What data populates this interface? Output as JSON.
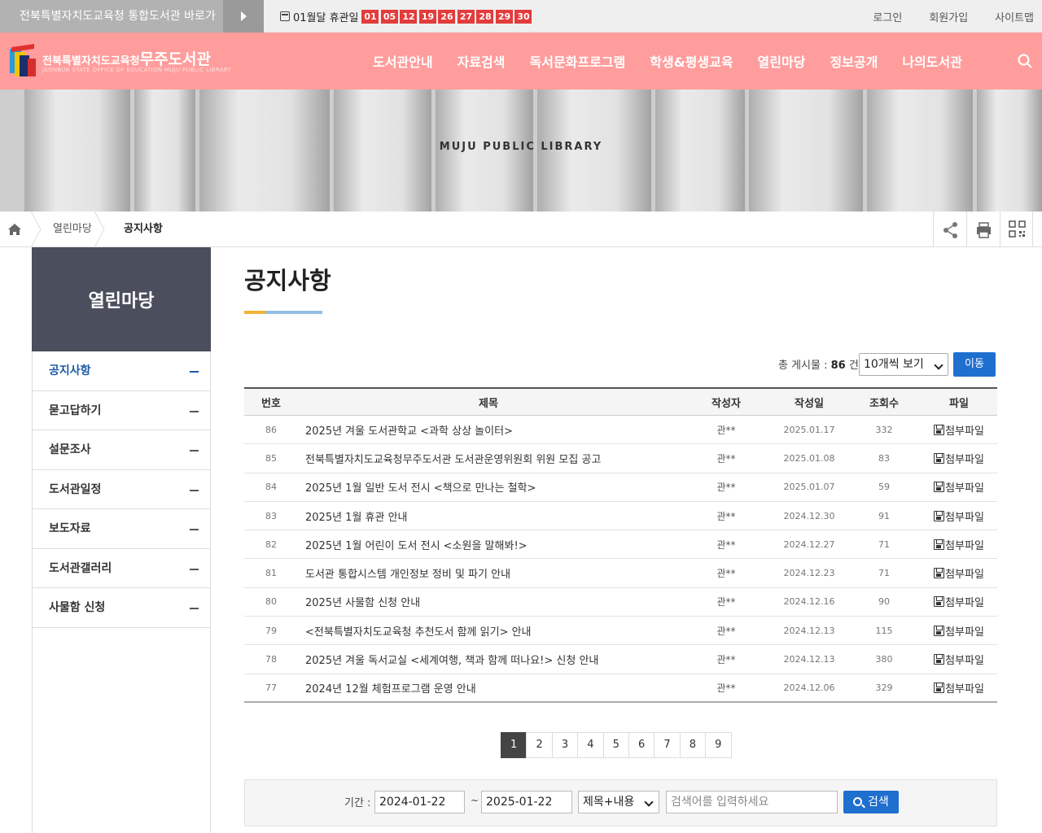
{
  "topbar": {
    "portal_link": "전북특별자치도교육청 통합도서관 바로가기",
    "holiday_label": "01월달 휴관일",
    "holiday_days": [
      "01",
      "05",
      "12",
      "19",
      "26",
      "27",
      "28",
      "29",
      "30"
    ],
    "util_links": [
      "로그인",
      "회원가입",
      "사이트맵"
    ]
  },
  "header": {
    "logo_small": "전북특별자치도교육청",
    "logo_big": "무주도서관",
    "logo_sub": "JEONBUK STATE OFFICE OF EDUCATION MUJU PUBLIC LIBRARY",
    "gnb": [
      "도서관안내",
      "자료검색",
      "독서문화프로그램",
      "학생&평생교육",
      "열린마당",
      "정보공개",
      "나의도서관"
    ]
  },
  "visual": {
    "title": "MUJU PUBLIC LIBRARY"
  },
  "breadcrumb": {
    "items": [
      "열린마당",
      "공지사항"
    ]
  },
  "sidebar": {
    "title": "열린마당",
    "items": [
      "공지사항",
      "묻고답하기",
      "설문조사",
      "도서관일정",
      "보도자료",
      "도서관갤러리",
      "사물함 신청"
    ],
    "active_index": 0
  },
  "content": {
    "title": "공지사항",
    "total_prefix": "총 게시물 : ",
    "total_count": "86",
    "total_suffix": " 건",
    "perpage": "10개씩 보기",
    "go_button": "이동"
  },
  "board": {
    "headers": {
      "no": "번호",
      "title": "제목",
      "writer": "작성자",
      "date": "작성일",
      "hits": "조회수",
      "file": "파일"
    },
    "rows": [
      {
        "no": "86",
        "title": "2025년 겨울 도서관학교 <과학 상상 놀이터>",
        "writer": "관**",
        "date": "2025.01.17",
        "hits": "332",
        "file": "첨부파일"
      },
      {
        "no": "85",
        "title": "전북특별자치도교육청무주도서관 도서관운영위원회 위원 모집 공고",
        "writer": "관**",
        "date": "2025.01.08",
        "hits": "83",
        "file": "첨부파일"
      },
      {
        "no": "84",
        "title": "2025년 1월 일반 도서 전시 <책으로 만나는 철학>",
        "writer": "관**",
        "date": "2025.01.07",
        "hits": "59",
        "file": "첨부파일"
      },
      {
        "no": "83",
        "title": "2025년 1월 휴관 안내",
        "writer": "관**",
        "date": "2024.12.30",
        "hits": "91",
        "file": "첨부파일"
      },
      {
        "no": "82",
        "title": "2025년 1월 어린이 도서 전시 <소원을 말해봐!>",
        "writer": "관**",
        "date": "2024.12.27",
        "hits": "71",
        "file": "첨부파일"
      },
      {
        "no": "81",
        "title": "도서관 통합시스템 개인정보 정비 및 파기 안내",
        "writer": "관**",
        "date": "2024.12.23",
        "hits": "71",
        "file": "첨부파일"
      },
      {
        "no": "80",
        "title": "2025년 사물함 신청 안내",
        "writer": "관**",
        "date": "2024.12.16",
        "hits": "90",
        "file": "첨부파일"
      },
      {
        "no": "79",
        "title": "<전북특별자치도교육청 추천도서 함께 읽기> 안내",
        "writer": "관**",
        "date": "2024.12.13",
        "hits": "115",
        "file": "첨부파일"
      },
      {
        "no": "78",
        "title": "2025년 겨울 독서교실 <세계여행, 책과 함께 떠나요!> 신청 안내",
        "writer": "관**",
        "date": "2024.12.13",
        "hits": "380",
        "file": "첨부파일"
      },
      {
        "no": "77",
        "title": "2024년 12월 체험프로그램 운영 안내",
        "writer": "관**",
        "date": "2024.12.06",
        "hits": "329",
        "file": "첨부파일"
      }
    ]
  },
  "paging": {
    "pages": [
      "1",
      "2",
      "3",
      "4",
      "5",
      "6",
      "7",
      "8",
      "9"
    ],
    "current": "1"
  },
  "search": {
    "period_label": "기간 :",
    "start_date": "2024-01-22",
    "tilde": "~",
    "end_date": "2025-01-22",
    "field": "제목+내용",
    "placeholder": "검색어를 입력하세요",
    "button": "검색"
  },
  "colors": {
    "header": "#ff9d9c",
    "accent": "#1f6fcf",
    "holiday": "#e33c3c",
    "sidebar_head": "#4b4e5c"
  }
}
